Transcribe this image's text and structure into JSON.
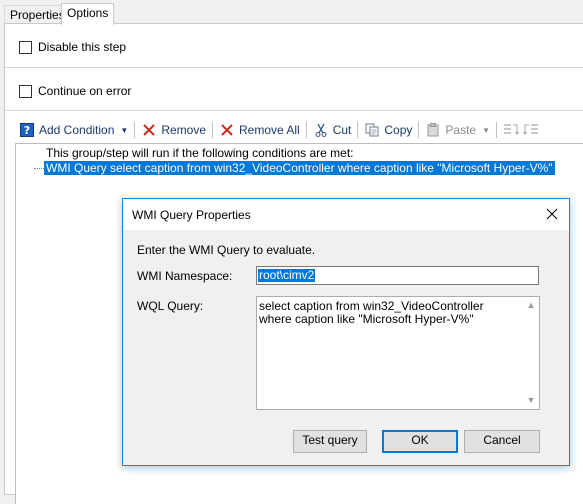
{
  "tabs": [
    {
      "label": "Properties",
      "active": false
    },
    {
      "label": "Options",
      "active": true
    }
  ],
  "options": {
    "disable_step": {
      "label": "Disable this step",
      "checked": false
    },
    "continue_on_error": {
      "label": "Continue on error",
      "checked": false
    }
  },
  "toolbar": {
    "add_condition": "Add Condition",
    "remove": "Remove",
    "remove_all": "Remove All",
    "cut": "Cut",
    "copy": "Copy",
    "paste": "Paste"
  },
  "conditions": {
    "header": "This group/step will run if the following conditions are met:",
    "items": [
      "WMI Query  select caption from win32_VideoController where caption like \"Microsoft Hyper-V%\""
    ]
  },
  "dialog": {
    "title": "WMI Query Properties",
    "instruction": "Enter the WMI Query to evaluate.",
    "namespace_label": "WMI Namespace:",
    "namespace_value": "root\\cimv2",
    "wql_label": "WQL Query:",
    "wql_value": "select caption from win32_VideoController where caption like \"Microsoft Hyper-V%\"",
    "buttons": {
      "test": "Test query",
      "ok": "OK",
      "cancel": "Cancel"
    }
  },
  "colors": {
    "selection": "#0078d7",
    "accent_red": "#c42b1c",
    "toolbar_text": "#1a3a6c"
  }
}
